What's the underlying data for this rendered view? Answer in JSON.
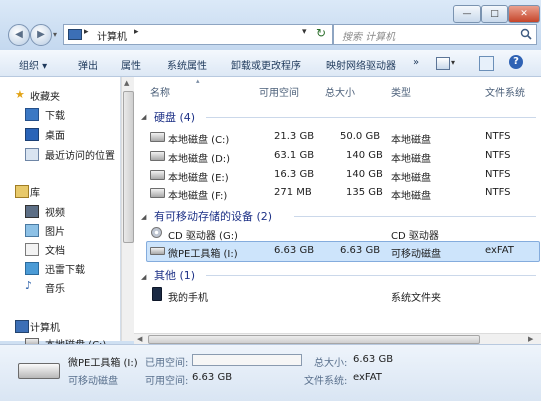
{
  "window": {
    "minimize": "—",
    "maximize": "□",
    "close": "✕"
  },
  "nav": {
    "back": "◀",
    "forward": "▶"
  },
  "address": {
    "path": "计算机",
    "separator": "▸",
    "dropdown": "▾",
    "refresh": "↻"
  },
  "search": {
    "placeholder": "搜索 计算机"
  },
  "toolbar": {
    "organize": "组织 ▾",
    "eject": "弹出",
    "properties": "属性",
    "system_properties": "系统属性",
    "uninstall": "卸载或更改程序",
    "map_drive": "映射网络驱动器",
    "more": "»",
    "help": "?"
  },
  "sidebar": {
    "favorites": "收藏夹",
    "downloads": "下载",
    "desktop": "桌面",
    "recent": "最近访问的位置",
    "libraries": "库",
    "videos": "视频",
    "pictures": "图片",
    "documents": "文档",
    "xunlei": "迅雷下载",
    "music": "音乐",
    "computer": "计算机",
    "local_c": "本地磁盘 (C:)"
  },
  "columns": {
    "name": "名称",
    "free": "可用空间",
    "total": "总大小",
    "type": "类型",
    "fs": "文件系统"
  },
  "groups": {
    "hdd": {
      "title": "硬盘 (4)"
    },
    "removable": {
      "title": "有可移动存储的设备 (2)"
    },
    "other": {
      "title": "其他 (1)"
    }
  },
  "drives": [
    {
      "name": "本地磁盘 (C:)",
      "free": "21.3 GB",
      "total": "50.0 GB",
      "type": "本地磁盘",
      "fs": "NTFS"
    },
    {
      "name": "本地磁盘 (D:)",
      "free": "63.1 GB",
      "total": "140 GB",
      "type": "本地磁盘",
      "fs": "NTFS"
    },
    {
      "name": "本地磁盘 (E:)",
      "free": "16.3 GB",
      "total": "140 GB",
      "type": "本地磁盘",
      "fs": "NTFS"
    },
    {
      "name": "本地磁盘 (F:)",
      "free": "271 MB",
      "total": "135 GB",
      "type": "本地磁盘",
      "fs": "NTFS"
    }
  ],
  "removable": [
    {
      "name": "CD 驱动器 (G:)",
      "free": "",
      "total": "",
      "type": "CD 驱动器",
      "fs": ""
    },
    {
      "name": "微PE工具箱 (I:)",
      "free": "6.63 GB",
      "total": "6.63 GB",
      "type": "可移动磁盘",
      "fs": "exFAT"
    }
  ],
  "other": [
    {
      "name": "我的手机",
      "type": "系统文件夹"
    }
  ],
  "details": {
    "name": "微PE工具箱 (I:)",
    "used_label": "已用空间:",
    "total_label": "总大小:",
    "total_value": "6.63 GB",
    "kind": "可移动磁盘",
    "free_label": "可用空间:",
    "free_value": "6.63 GB",
    "fs_label": "文件系统:",
    "fs_value": "exFAT",
    "used_fraction": 0.0
  },
  "colors": {
    "accent": "#1e3287",
    "selected": "#cde4fb"
  }
}
